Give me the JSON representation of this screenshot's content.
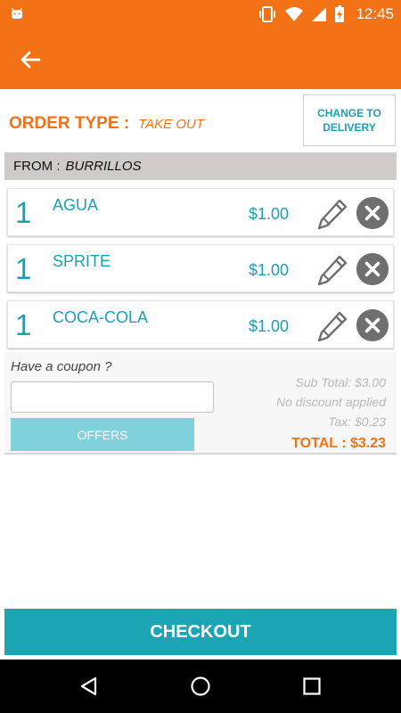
{
  "status_bar": {
    "time": "12:45",
    "icons": [
      "android-icon",
      "vibrate-icon",
      "wifi-icon",
      "signal-icon",
      "battery-charging-icon"
    ]
  },
  "app_bar": {
    "back_icon": "arrow-left-icon",
    "color": "#f47216"
  },
  "order_type": {
    "label": "ORDER TYPE :",
    "value": "TAKE OUT",
    "change_button": "CHANGE TO DELIVERY"
  },
  "from": {
    "label": "FROM :",
    "restaurant": "BURRILLOS"
  },
  "items": [
    {
      "qty": "1",
      "name": "AGUA",
      "price": "$1.00"
    },
    {
      "qty": "1",
      "name": "SPRITE",
      "price": "$1.00"
    },
    {
      "qty": "1",
      "name": "COCA-COLA",
      "price": "$1.00"
    }
  ],
  "coupon": {
    "label": "Have a coupon ?",
    "value": "",
    "placeholder": "",
    "offers_button": "OFFERS"
  },
  "totals": {
    "subtotal": "Sub Total: $3.00",
    "discount": "No discount applied",
    "tax": "Tax: $0.23",
    "total": "TOTAL : $3.23"
  },
  "checkout_label": "CHECKOUT",
  "colors": {
    "accent": "#f47216",
    "teal": "#1aa4b4",
    "offers": "#7fd2db"
  }
}
